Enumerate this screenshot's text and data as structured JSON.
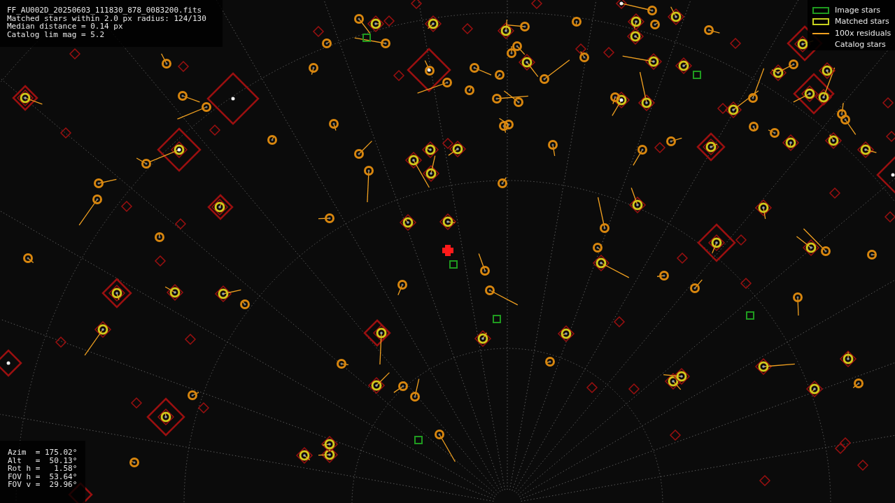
{
  "info_panel": {
    "lines": [
      "FF_AU002D_20250603_111830_878_0083200.fits",
      "Matched stars within 2.0 px radius: 124/130",
      "Median distance = 0.14 px",
      "Catalog lim mag = 5.2"
    ]
  },
  "legend": [
    {
      "kind": "image",
      "label": "Image stars",
      "color": "#1f9a1f"
    },
    {
      "kind": "matched",
      "label": "Matched stars",
      "color": "#c8d21e"
    },
    {
      "kind": "residual",
      "label": "100x residuals",
      "color": "#f0a020"
    },
    {
      "kind": "catalog",
      "label": "Catalog stars"
    }
  ],
  "pointing_panel": {
    "lines": [
      "Azim  = 175.02°",
      "Alt   =  50.13°",
      "Rot h =   1.58°",
      "FOV h =  53.64°",
      "FOV v =  29.96°"
    ]
  }
}
